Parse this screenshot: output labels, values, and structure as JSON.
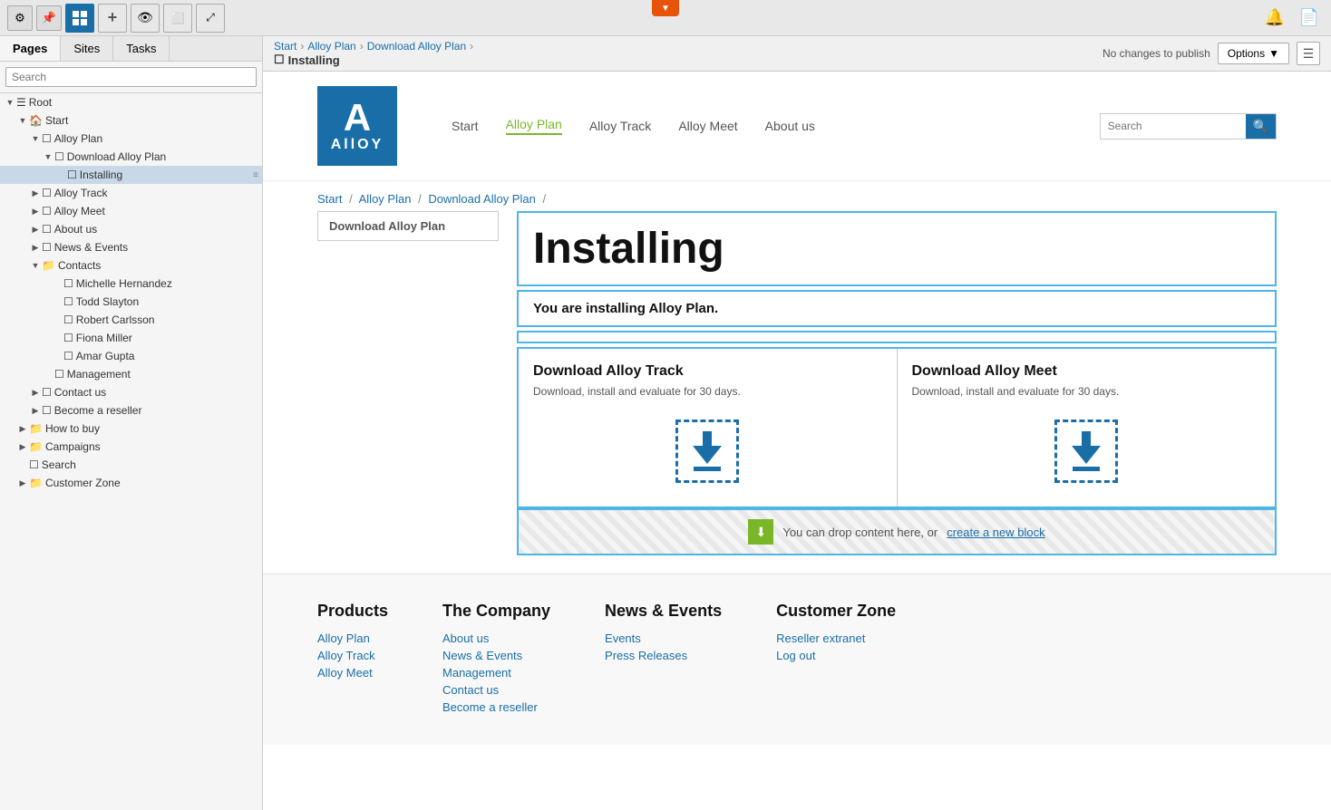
{
  "toolbar": {
    "tabs": [
      "Pages",
      "Sites",
      "Tasks"
    ],
    "active_tab": "Pages",
    "search_placeholder": "Search"
  },
  "breadcrumb": {
    "path": [
      "Start",
      "Alloy Plan",
      "Download Alloy Plan"
    ],
    "current": "Installing",
    "no_changes": "No changes to publish",
    "options_label": "Options"
  },
  "tree": {
    "items": [
      {
        "label": "Root",
        "level": 0,
        "type": "root",
        "expanded": true
      },
      {
        "label": "Start",
        "level": 1,
        "type": "home",
        "expanded": true
      },
      {
        "label": "Alloy Plan",
        "level": 2,
        "type": "page",
        "expanded": true
      },
      {
        "label": "Download Alloy Plan",
        "level": 3,
        "type": "page",
        "expanded": true
      },
      {
        "label": "Installing",
        "level": 4,
        "type": "page",
        "selected": true
      },
      {
        "label": "Alloy Track",
        "level": 2,
        "type": "page"
      },
      {
        "label": "Alloy Meet",
        "level": 2,
        "type": "page"
      },
      {
        "label": "About us",
        "level": 2,
        "type": "page"
      },
      {
        "label": "News & Events",
        "level": 2,
        "type": "page",
        "expanded": true
      },
      {
        "label": "Contacts",
        "level": 2,
        "type": "folder",
        "expanded": true
      },
      {
        "label": "Michelle Hernandez",
        "level": 3,
        "type": "page"
      },
      {
        "label": "Todd Slayton",
        "level": 3,
        "type": "page"
      },
      {
        "label": "Robert Carlsson",
        "level": 3,
        "type": "page"
      },
      {
        "label": "Fiona Miller",
        "level": 3,
        "type": "page"
      },
      {
        "label": "Amar Gupta",
        "level": 3,
        "type": "page"
      },
      {
        "label": "Management",
        "level": 3,
        "type": "page"
      },
      {
        "label": "Contact us",
        "level": 2,
        "type": "page"
      },
      {
        "label": "Become a reseller",
        "level": 2,
        "type": "page"
      },
      {
        "label": "How to buy",
        "level": 1,
        "type": "folder"
      },
      {
        "label": "Campaigns",
        "level": 1,
        "type": "folder"
      },
      {
        "label": "Search",
        "level": 1,
        "type": "page"
      },
      {
        "label": "Customer Zone",
        "level": 1,
        "type": "folder"
      }
    ]
  },
  "alloy_site": {
    "logo_a": "A",
    "logo_text": "AllOY",
    "nav": [
      {
        "label": "Start",
        "active": false
      },
      {
        "label": "Alloy Plan",
        "active": true
      },
      {
        "label": "Alloy Track",
        "active": false
      },
      {
        "label": "Alloy Meet",
        "active": false
      },
      {
        "label": "About us",
        "active": false
      }
    ],
    "search_placeholder": "Search",
    "breadcrumb": [
      "Start",
      "Alloy Plan",
      "Download Alloy Plan"
    ],
    "sidebar_item": "Download Alloy Plan",
    "page_title": "Installing",
    "page_subtitle": "You are installing Alloy Plan.",
    "download_cards": [
      {
        "title": "Download Alloy Track",
        "desc": "Download, install and evaluate for 30 days."
      },
      {
        "title": "Download Alloy Meet",
        "desc": "Download, install and evaluate for 30 days."
      }
    ],
    "drop_zone_text": "You can drop content here, or",
    "drop_zone_link": "create a new block",
    "footer": {
      "cols": [
        {
          "heading": "Products",
          "links": [
            "Alloy Plan",
            "Alloy Track",
            "Alloy Meet"
          ]
        },
        {
          "heading": "The Company",
          "links": [
            "About us",
            "News & Events",
            "Management",
            "Contact us",
            "Become a reseller"
          ]
        },
        {
          "heading": "News & Events",
          "links": [
            "Events",
            "Press Releases"
          ]
        },
        {
          "heading": "Customer Zone",
          "links": [
            "Reseller extranet",
            "Log out"
          ]
        }
      ]
    }
  }
}
